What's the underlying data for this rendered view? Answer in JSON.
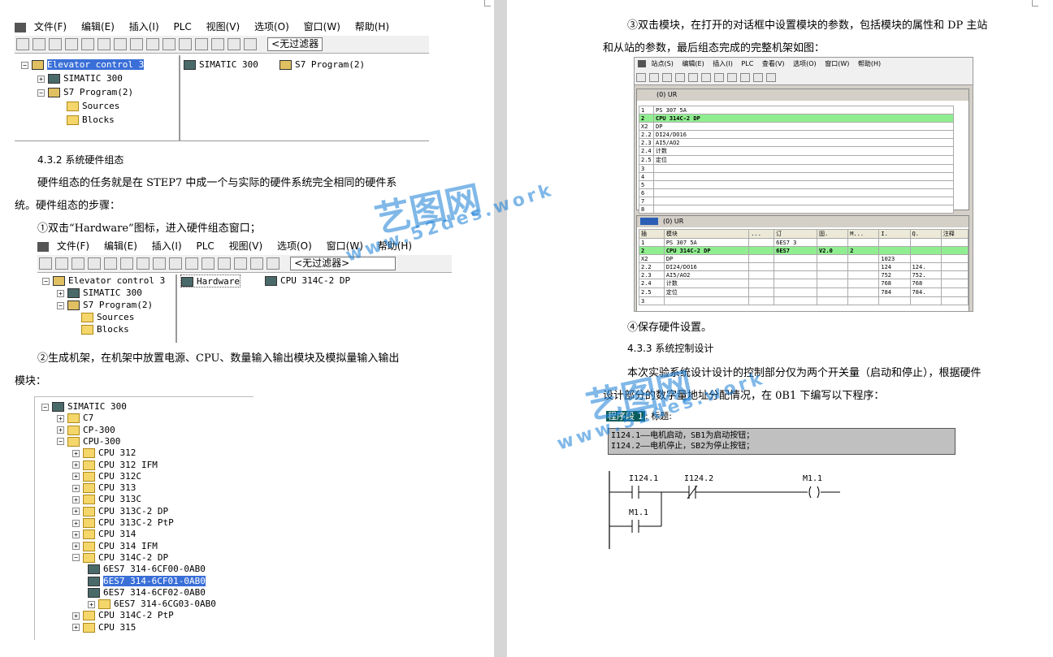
{
  "watermark": {
    "brand": "艺图网",
    "url": "www.52des.work"
  },
  "left": {
    "shot1": {
      "menu": [
        "文件(F)",
        "编辑(E)",
        "插入(I)",
        "PLC",
        "视图(V)",
        "选项(O)",
        "窗口(W)",
        "帮助(H)"
      ],
      "filter": "<无过滤器",
      "tree": [
        "Elevator control 3",
        "SIMATIC 300",
        "S7 Program(2)",
        "Sources",
        "Blocks"
      ],
      "right_items": [
        "SIMATIC 300",
        "S7 Program(2)"
      ]
    },
    "heading": "4.3.2  系统硬件组态",
    "p1": "硬件组态的任务就是在 STEP7 中成一个与实际的硬件系统完全相同的硬件系",
    "p1b": "统。硬件组态的步骤：",
    "step1": "①双击“Hardware”图标，进入硬件组态窗口；",
    "shot2": {
      "menu": [
        "文件(F)",
        "编辑(E)",
        "插入(I)",
        "PLC",
        "视图(V)",
        "选项(O)",
        "窗口(W)",
        "帮助(H)"
      ],
      "filter": "<无过滤器>",
      "tree": [
        "Elevator control 3",
        "SIMATIC 300",
        "S7 Program(2)",
        "Sources",
        "Blocks"
      ],
      "right_items": [
        "Hardware",
        "CPU 314C-2 DP"
      ]
    },
    "step2": "②生成机架，在机架中放置电源、CPU、数量输入输出模块及模拟量输入输出",
    "step2b": "模块：",
    "catalog": [
      "SIMATIC 300",
      "C7",
      "CP-300",
      "CPU-300",
      "CPU 312",
      "CPU 312 IFM",
      "CPU 312C",
      "CPU 313",
      "CPU 313C",
      "CPU 313C-2 DP",
      "CPU 313C-2 PtP",
      "CPU 314",
      "CPU 314 IFM",
      "CPU 314C-2 DP",
      "6ES7 314-6CF00-0AB0",
      "6ES7 314-6CF01-0AB0",
      "6ES7 314-6CF02-0AB0",
      "6ES7 314-6CG03-0AB0",
      "CPU 314C-2 PtP",
      "CPU 315"
    ]
  },
  "right": {
    "step3": "③双击模块，在打开的对话框中设置模块的参数，包括模块的属性和 DP 主站",
    "step3b": "和从站的参数，最后组态完成的完整机架如图：",
    "hw": {
      "menu": [
        "站点(S)",
        "编辑(E)",
        "插入(I)",
        "PLC",
        "查看(V)",
        "选项(O)",
        "窗口(W)",
        "帮助(H)"
      ],
      "rack_title": "(0) UR",
      "rack_rows": [
        [
          "1",
          "PS 307 5A"
        ],
        [
          "2",
          "CPU 314C-2 DP"
        ],
        [
          "X2",
          "DP"
        ],
        [
          "2.2",
          "DI24/DO16"
        ],
        [
          "2.3",
          "AI5/AO2"
        ],
        [
          "2.4",
          "计数"
        ],
        [
          "2.5",
          "定位"
        ],
        [
          "3",
          ""
        ],
        [
          "4",
          ""
        ],
        [
          "5",
          ""
        ],
        [
          "6",
          ""
        ],
        [
          "7",
          ""
        ],
        [
          "8",
          ""
        ]
      ],
      "detail_title": "(0)   UR",
      "detail_headers": [
        "插",
        "模块",
        "...",
        "订",
        "固.",
        "M...",
        "I.",
        "Q.",
        "注释"
      ],
      "detail_rows": [
        [
          "1",
          "PS 307 5A",
          "",
          "6ES7 3",
          "",
          "",
          "",
          "",
          ""
        ],
        [
          "2",
          "CPU 314C-2 DP",
          "",
          "6ES7",
          "V2.0",
          "2",
          "",
          "",
          ""
        ],
        [
          "X2",
          "DP",
          "",
          "",
          "",
          "",
          "1023",
          "",
          ""
        ],
        [
          "2.2",
          "DI24/DO16",
          "",
          "",
          "",
          "",
          "124",
          "124.",
          ""
        ],
        [
          "2.3",
          "AI5/AO2",
          "",
          "",
          "",
          "",
          "752",
          "752.",
          ""
        ],
        [
          "2.4",
          "计数",
          "",
          "",
          "",
          "",
          "768",
          "768",
          ""
        ],
        [
          "2.5",
          "定位",
          "",
          "",
          "",
          "",
          "784",
          "784.",
          ""
        ],
        [
          "3",
          "",
          "",
          "",
          "",
          "",
          "",
          "",
          ""
        ]
      ]
    },
    "step4": "④保存硬件设置。",
    "heading": "4.3.3  系统控制设计",
    "p1": "本次实验系统设计设计的控制部分仅为两个开关量（启动和停止），根据硬件",
    "p1b": "设计部分的数字量地址分配情况，在 0B1 下编写以下程序：",
    "network": {
      "label": "程序段",
      "num": "1",
      "title": ": 标题:",
      "comment": [
        "I124.1——电机启动，SB1为启动按钮；",
        "I124.2——电机停止，SB2为停止按钮；"
      ],
      "contacts": [
        "I124.1",
        "I124.2",
        "M1.1",
        "M1.1"
      ],
      "coil_symbol": "( )"
    }
  }
}
